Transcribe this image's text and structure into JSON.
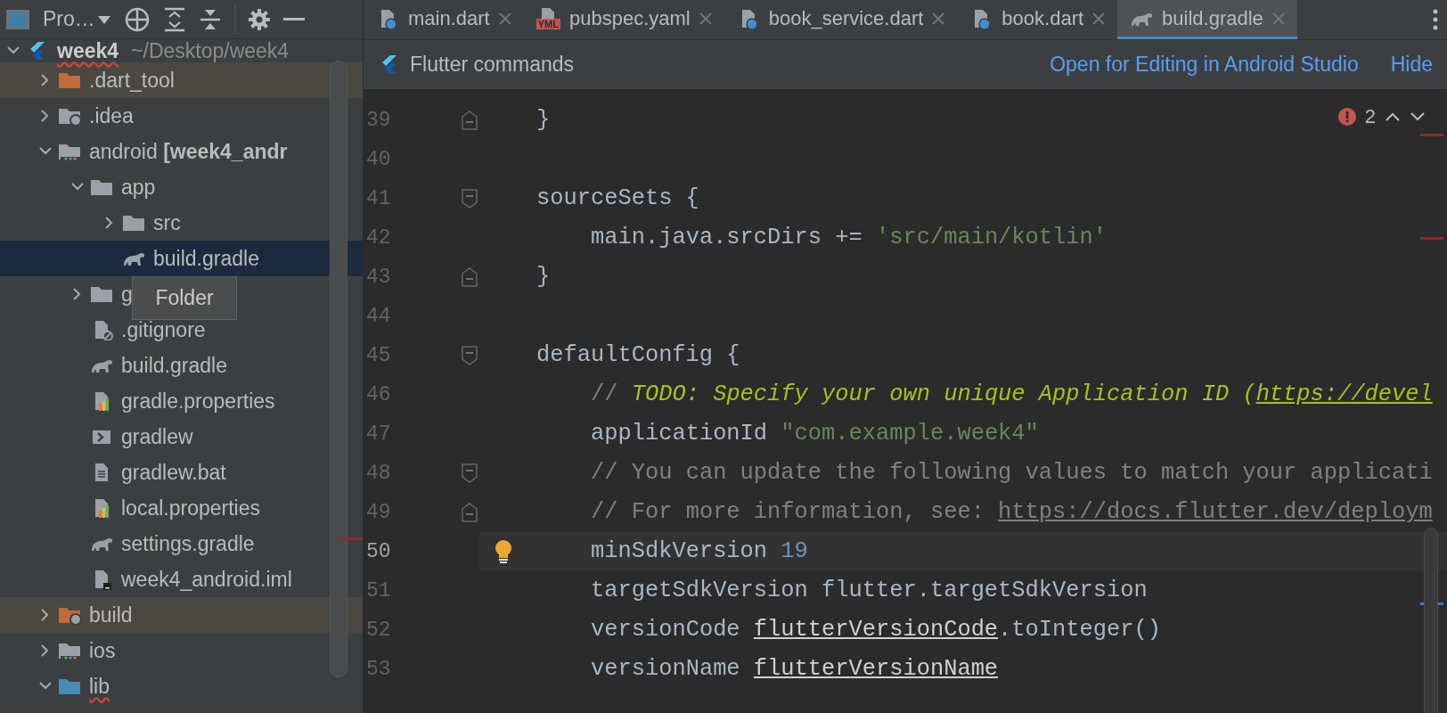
{
  "sidebar": {
    "view_label": "Pro…",
    "tree": [
      {
        "label": "week4",
        "suffix": "~/Desktop/week4",
        "kind": "flutter",
        "expanded": true,
        "selected": false,
        "highlighted": false,
        "typo": true,
        "children": [
          {
            "label": ".dart_tool",
            "kind": "folder_excluded",
            "expanded": false,
            "selected": false,
            "highlighted": true,
            "typo": false
          },
          {
            "label": ".idea",
            "kind": "folder_idea",
            "expanded": false,
            "selected": false,
            "highlighted": false,
            "typo": false
          },
          {
            "label": "android **[week4_andr**",
            "kind": "module",
            "expanded": true,
            "selected": false,
            "highlighted": false,
            "typo": false,
            "children": [
              {
                "label": "app",
                "kind": "folder",
                "expanded": true,
                "selected": false,
                "highlighted": false,
                "typo": false,
                "children": [
                  {
                    "label": "src",
                    "kind": "folder",
                    "expanded": false,
                    "selected": false,
                    "highlighted": false,
                    "typo": false
                  },
                  {
                    "label": "build.gradle",
                    "kind": "gradle",
                    "selected": true,
                    "highlighted": false,
                    "typo": false
                  }
                ]
              },
              {
                "label": "g",
                "kind": "folder",
                "expanded": false,
                "selected": false,
                "highlighted": false,
                "typo": false
              },
              {
                "label": ".gitignore",
                "kind": "ignore",
                "selected": false,
                "highlighted": false,
                "typo": false
              },
              {
                "label": "build.gradle",
                "kind": "gradle",
                "selected": false,
                "highlighted": false,
                "typo": false
              },
              {
                "label": "gradle.properties",
                "kind": "properties",
                "selected": false,
                "highlighted": false,
                "typo": false
              },
              {
                "label": "gradlew",
                "kind": "shell",
                "selected": false,
                "highlighted": false,
                "typo": false
              },
              {
                "label": "gradlew.bat",
                "kind": "text",
                "selected": false,
                "highlighted": false,
                "typo": false
              },
              {
                "label": "local.properties",
                "kind": "properties",
                "selected": false,
                "highlighted": false,
                "typo": false
              },
              {
                "label": "settings.gradle",
                "kind": "gradle",
                "selected": false,
                "highlighted": false,
                "typo": false
              },
              {
                "label": "week4_android.iml",
                "kind": "iml",
                "selected": false,
                "highlighted": false,
                "typo": false
              }
            ]
          },
          {
            "label": "build",
            "kind": "folder_excluded_gear",
            "expanded": false,
            "selected": false,
            "highlighted": true,
            "typo": false
          },
          {
            "label": "ios",
            "kind": "module",
            "expanded": false,
            "selected": false,
            "highlighted": false,
            "typo": false
          },
          {
            "label": "lib",
            "kind": "folder_source",
            "expanded": true,
            "selected": false,
            "highlighted": false,
            "typo": true
          }
        ]
      }
    ],
    "tooltip": "Folder"
  },
  "tabs": [
    {
      "label": "main.dart",
      "kind": "dart",
      "selected": false
    },
    {
      "label": "pubspec.yaml",
      "kind": "yaml",
      "badge": "YML",
      "selected": false
    },
    {
      "label": "book_service.dart",
      "kind": "dart",
      "selected": false
    },
    {
      "label": "book.dart",
      "kind": "dart",
      "selected": false
    },
    {
      "label": "build.gradle",
      "kind": "gradle",
      "selected": true
    }
  ],
  "flutter_bar": {
    "title": "Flutter commands",
    "links": [
      "Open for Editing in Android Studio",
      "Hide"
    ]
  },
  "problems": {
    "count": "2"
  },
  "lines": [
    {
      "number": "39",
      "fold_start": false,
      "fold_end": true,
      "current": false,
      "bulb": false,
      "tokens": [
        {
          "kind": "plain",
          "text": "}"
        }
      ]
    },
    {
      "number": "40",
      "fold_start": false,
      "fold_end": false,
      "current": false,
      "bulb": false
    },
    {
      "number": "41",
      "fold_start": true,
      "fold_end": false,
      "current": false,
      "bulb": false,
      "tokens": [
        {
          "kind": "plain",
          "text": "sourceSets {"
        }
      ],
      "children": [
        {
          "number": "42",
          "fold_start": false,
          "fold_end": false,
          "current": false,
          "bulb": false,
          "tokens": [
            {
              "kind": "plain",
              "text": "main.java.srcDirs += "
            },
            {
              "kind": "string",
              "text": "'src/main/kotlin'"
            }
          ]
        }
      ]
    },
    {
      "number": "43",
      "fold_start": false,
      "fold_end": true,
      "current": false,
      "bulb": false,
      "tokens": [
        {
          "kind": "plain",
          "text": "}"
        }
      ]
    },
    {
      "number": "44",
      "fold_start": false,
      "fold_end": false,
      "current": false,
      "bulb": false
    },
    {
      "number": "45",
      "fold_start": true,
      "fold_end": false,
      "current": false,
      "bulb": false,
      "tokens": [
        {
          "kind": "plain",
          "text": "defaultConfig {"
        }
      ],
      "children": [
        {
          "number": "46",
          "fold_start": false,
          "fold_end": false,
          "current": false,
          "bulb": false,
          "tokens": [
            {
              "kind": "comment",
              "text": "// "
            },
            {
              "kind": "todo",
              "text": "TODO: Specify your own unique Application ID ("
            },
            {
              "kind": "todo_link",
              "text": "https://devel"
            }
          ]
        },
        {
          "number": "47",
          "fold_start": false,
          "fold_end": false,
          "current": false,
          "bulb": false,
          "tokens": [
            {
              "kind": "plain",
              "text": "applicationId "
            },
            {
              "kind": "string",
              "text": "\"com.example.week4\""
            }
          ]
        },
        {
          "number": "48",
          "fold_start": true,
          "fold_end": false,
          "current": false,
          "bulb": false,
          "tokens": [
            {
              "kind": "comment",
              "text": "// You can update the following values to match your applicati"
            }
          ]
        },
        {
          "number": "49",
          "fold_start": false,
          "fold_end": true,
          "current": false,
          "bulb": false,
          "tokens": [
            {
              "kind": "comment",
              "text": "// For more information, see: "
            },
            {
              "kind": "comment_link",
              "text": "https://docs.flutter.dev/deploym"
            }
          ]
        },
        {
          "number": "50",
          "fold_start": false,
          "fold_end": false,
          "current": true,
          "bulb": true,
          "tokens": [
            {
              "kind": "plain",
              "text": "minSdkVersion "
            },
            {
              "kind": "number",
              "text": "19"
            }
          ]
        },
        {
          "number": "51",
          "fold_start": false,
          "fold_end": false,
          "current": false,
          "bulb": false,
          "tokens": [
            {
              "kind": "plain",
              "text": "targetSdkVersion flutter.targetSdkVersion"
            }
          ]
        },
        {
          "number": "52",
          "fold_start": false,
          "fold_end": false,
          "current": false,
          "bulb": false,
          "tokens": [
            {
              "kind": "plain",
              "text": "versionCode "
            },
            {
              "kind": "ref",
              "text": "flutterVersionCode"
            },
            {
              "kind": "plain",
              "text": ".toInteger()"
            }
          ]
        },
        {
          "number": "53",
          "fold_start": false,
          "fold_end": false,
          "current": false,
          "bulb": false,
          "tokens": [
            {
              "kind": "plain",
              "text": "versionName "
            },
            {
              "kind": "ref",
              "text": "flutterVersionName"
            }
          ]
        }
      ]
    }
  ]
}
